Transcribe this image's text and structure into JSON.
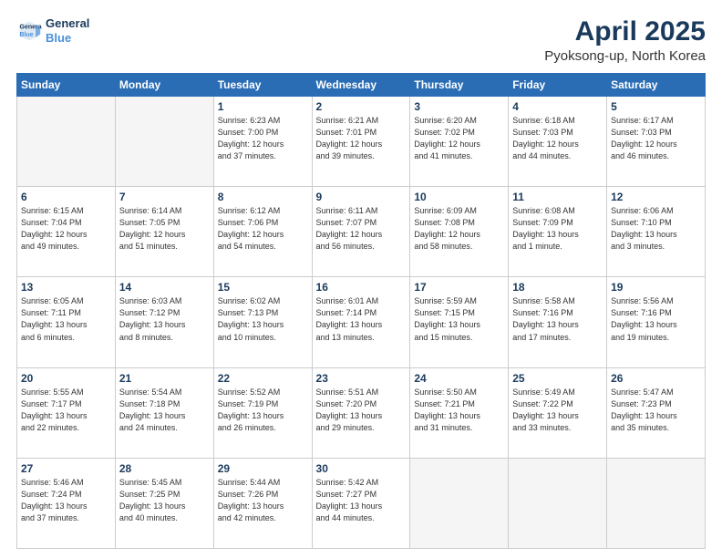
{
  "logo": {
    "line1": "General",
    "line2": "Blue"
  },
  "title": "April 2025",
  "location": "Pyoksong-up, North Korea",
  "days_header": [
    "Sunday",
    "Monday",
    "Tuesday",
    "Wednesday",
    "Thursday",
    "Friday",
    "Saturday"
  ],
  "weeks": [
    [
      {
        "day": "",
        "info": ""
      },
      {
        "day": "",
        "info": ""
      },
      {
        "day": "1",
        "info": "Sunrise: 6:23 AM\nSunset: 7:00 PM\nDaylight: 12 hours\nand 37 minutes."
      },
      {
        "day": "2",
        "info": "Sunrise: 6:21 AM\nSunset: 7:01 PM\nDaylight: 12 hours\nand 39 minutes."
      },
      {
        "day": "3",
        "info": "Sunrise: 6:20 AM\nSunset: 7:02 PM\nDaylight: 12 hours\nand 41 minutes."
      },
      {
        "day": "4",
        "info": "Sunrise: 6:18 AM\nSunset: 7:03 PM\nDaylight: 12 hours\nand 44 minutes."
      },
      {
        "day": "5",
        "info": "Sunrise: 6:17 AM\nSunset: 7:03 PM\nDaylight: 12 hours\nand 46 minutes."
      }
    ],
    [
      {
        "day": "6",
        "info": "Sunrise: 6:15 AM\nSunset: 7:04 PM\nDaylight: 12 hours\nand 49 minutes."
      },
      {
        "day": "7",
        "info": "Sunrise: 6:14 AM\nSunset: 7:05 PM\nDaylight: 12 hours\nand 51 minutes."
      },
      {
        "day": "8",
        "info": "Sunrise: 6:12 AM\nSunset: 7:06 PM\nDaylight: 12 hours\nand 54 minutes."
      },
      {
        "day": "9",
        "info": "Sunrise: 6:11 AM\nSunset: 7:07 PM\nDaylight: 12 hours\nand 56 minutes."
      },
      {
        "day": "10",
        "info": "Sunrise: 6:09 AM\nSunset: 7:08 PM\nDaylight: 12 hours\nand 58 minutes."
      },
      {
        "day": "11",
        "info": "Sunrise: 6:08 AM\nSunset: 7:09 PM\nDaylight: 13 hours\nand 1 minute."
      },
      {
        "day": "12",
        "info": "Sunrise: 6:06 AM\nSunset: 7:10 PM\nDaylight: 13 hours\nand 3 minutes."
      }
    ],
    [
      {
        "day": "13",
        "info": "Sunrise: 6:05 AM\nSunset: 7:11 PM\nDaylight: 13 hours\nand 6 minutes."
      },
      {
        "day": "14",
        "info": "Sunrise: 6:03 AM\nSunset: 7:12 PM\nDaylight: 13 hours\nand 8 minutes."
      },
      {
        "day": "15",
        "info": "Sunrise: 6:02 AM\nSunset: 7:13 PM\nDaylight: 13 hours\nand 10 minutes."
      },
      {
        "day": "16",
        "info": "Sunrise: 6:01 AM\nSunset: 7:14 PM\nDaylight: 13 hours\nand 13 minutes."
      },
      {
        "day": "17",
        "info": "Sunrise: 5:59 AM\nSunset: 7:15 PM\nDaylight: 13 hours\nand 15 minutes."
      },
      {
        "day": "18",
        "info": "Sunrise: 5:58 AM\nSunset: 7:16 PM\nDaylight: 13 hours\nand 17 minutes."
      },
      {
        "day": "19",
        "info": "Sunrise: 5:56 AM\nSunset: 7:16 PM\nDaylight: 13 hours\nand 19 minutes."
      }
    ],
    [
      {
        "day": "20",
        "info": "Sunrise: 5:55 AM\nSunset: 7:17 PM\nDaylight: 13 hours\nand 22 minutes."
      },
      {
        "day": "21",
        "info": "Sunrise: 5:54 AM\nSunset: 7:18 PM\nDaylight: 13 hours\nand 24 minutes."
      },
      {
        "day": "22",
        "info": "Sunrise: 5:52 AM\nSunset: 7:19 PM\nDaylight: 13 hours\nand 26 minutes."
      },
      {
        "day": "23",
        "info": "Sunrise: 5:51 AM\nSunset: 7:20 PM\nDaylight: 13 hours\nand 29 minutes."
      },
      {
        "day": "24",
        "info": "Sunrise: 5:50 AM\nSunset: 7:21 PM\nDaylight: 13 hours\nand 31 minutes."
      },
      {
        "day": "25",
        "info": "Sunrise: 5:49 AM\nSunset: 7:22 PM\nDaylight: 13 hours\nand 33 minutes."
      },
      {
        "day": "26",
        "info": "Sunrise: 5:47 AM\nSunset: 7:23 PM\nDaylight: 13 hours\nand 35 minutes."
      }
    ],
    [
      {
        "day": "27",
        "info": "Sunrise: 5:46 AM\nSunset: 7:24 PM\nDaylight: 13 hours\nand 37 minutes."
      },
      {
        "day": "28",
        "info": "Sunrise: 5:45 AM\nSunset: 7:25 PM\nDaylight: 13 hours\nand 40 minutes."
      },
      {
        "day": "29",
        "info": "Sunrise: 5:44 AM\nSunset: 7:26 PM\nDaylight: 13 hours\nand 42 minutes."
      },
      {
        "day": "30",
        "info": "Sunrise: 5:42 AM\nSunset: 7:27 PM\nDaylight: 13 hours\nand 44 minutes."
      },
      {
        "day": "",
        "info": ""
      },
      {
        "day": "",
        "info": ""
      },
      {
        "day": "",
        "info": ""
      }
    ]
  ]
}
